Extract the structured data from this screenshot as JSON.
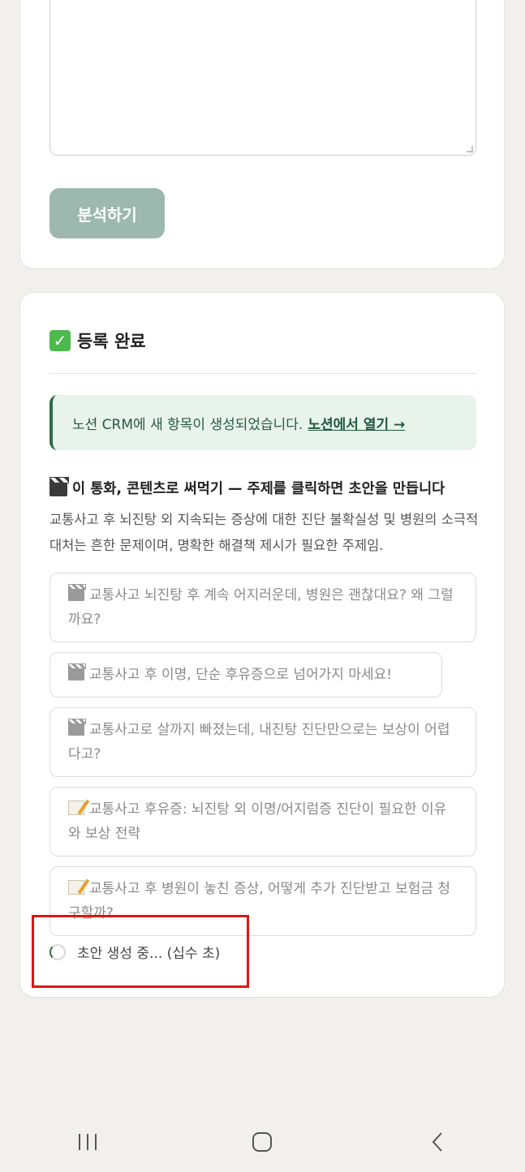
{
  "form": {
    "analyze_label": "분석하기"
  },
  "result": {
    "title": "등록 완료",
    "notice_text": "노션 CRM에 새 항목이 생성되었습니다.",
    "notice_link": "노션에서 열기 →",
    "section_title": "이 통화, 콘텐츠로 써먹기 — 주제를 클릭하면 초안을 만듭니다",
    "description": "교통사고 후 뇌진탕 외 지속되는 증상에 대한 진단 불확실성 및 병원의 소극적 대처는 흔한 문제이며, 명확한 해결책 제시가 필요한 주제임.",
    "topics": [
      {
        "type": "video",
        "icon": "clapper-icon",
        "text": "교통사고 뇌진탕 후 계속 어지러운데, 병원은 괜찮대요? 왜 그럴까요?"
      },
      {
        "type": "video",
        "icon": "clapper-icon",
        "text": "교통사고 후 이명, 단순 후유증으로 넘어가지 마세요!"
      },
      {
        "type": "video",
        "icon": "clapper-icon",
        "text": "교통사고로 살까지 빠졌는데, 내진탕 진단만으로는 보상이 어렵다고?"
      },
      {
        "type": "article",
        "icon": "memo-icon",
        "text": "교통사고 후유증: 뇌진탕 외 이명/어지럼증 진단이 필요한 이유와 보상 전략"
      },
      {
        "type": "article",
        "icon": "memo-icon",
        "text": "교통사고 후 병원이 놓친 증상, 어떻게 추가 진단받고 보험금 청구할까?"
      }
    ],
    "loading_text": "초안 생성 중... (십수 초)"
  },
  "colors": {
    "accent": "#2f6a4a",
    "button_disabled": "#9cb8af",
    "notice_bg": "#e8f3ec",
    "highlight": "#e01515"
  }
}
